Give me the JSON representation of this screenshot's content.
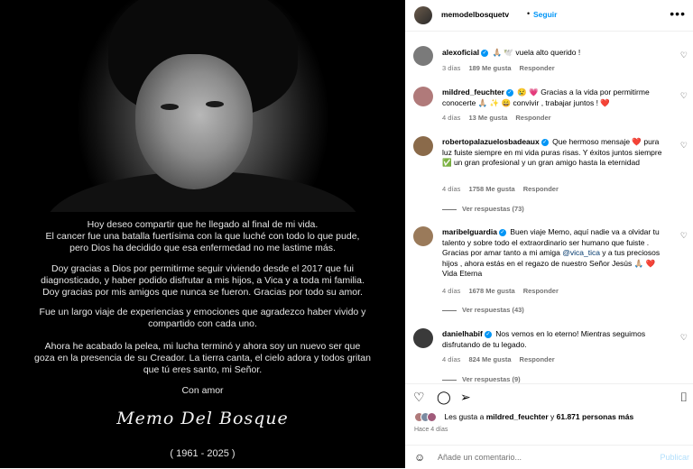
{
  "post": {
    "letter": [
      [
        "Hoy deseo compartir que he llegado al final de mi vida.",
        "El cancer fue una batalla fuertísima con la que luché con todo lo que pude,",
        "pero Dios ha decidido que esa enfermedad no me lastime más."
      ],
      [
        "Doy gracias a Dios por permitirme seguir viviendo desde el 2017 que fui",
        "diagnosticado, y haber podido disfrutar a mis hijos, a Vica y a toda mi familia.",
        "Doy gracias por mis amigos que nunca se fueron. Gracias por todo su amor."
      ],
      [
        "Fue un largo viaje de experiencias y emociones que agradezco haber vivido y",
        "compartido con cada uno."
      ],
      [
        "Ahora he acabado la pelea, mi lucha terminó y ahora soy un nuevo ser que",
        "goza en la presencia de su Creador.  La tierra canta, el cielo adora y todos gritan",
        "que tú eres santo, mi Señor."
      ],
      [
        "Con amor"
      ]
    ],
    "signature": "Memo Del Bosque",
    "years": "( 1961 - 2025 )"
  },
  "header": {
    "username": "memodelbosquetv",
    "separator": "•",
    "follow_label": "Seguir",
    "more_icon": "more-horizontal-icon"
  },
  "comments": [
    {
      "user": "alexoficial",
      "text": "🙏🏼 🕊️ vuela alto querido !",
      "age": "3 días",
      "likes": "189 Me gusta",
      "reply": "Responder",
      "avatar_color": "#7a7a7a"
    },
    {
      "user": "mildred_feuchter",
      "text": "😢 💗  Gracias a la vida por permitirme conocerte 🙏🏼 ✨ 😄 convivir , trabajar juntos ! ❤️",
      "age": "4 días",
      "likes": "13 Me gusta",
      "reply": "Responder",
      "avatar_color": "#b07a7a"
    },
    {
      "user": "robertopalazuelosbadeaux",
      "text": "Que hermoso mensaje ❤️ pura luz fuiste siempre en mi vida puras risas. Y éxitos juntos siempre ✅ un gran profesional y un gran amigo hasta la eternidad",
      "age": "4 días",
      "likes": "1758 Me gusta",
      "reply": "Responder",
      "view_replies": "Ver respuestas (73)",
      "avatar_color": "#8a6a4a"
    },
    {
      "user": "maribelguardia",
      "text_before": "Buen viaje Memo, aquí nadie va a olvidar tu talento y sobre todo el extraordinario ser humano que fuiste . Gracias por amar tanto a mi amiga ",
      "mention": "@vica_tica",
      "text_after": " y a tus preciosos hijos , ahora estás en el regazo de nuestro Señor Jesús 🙏🏼 ❤️ Vida Eterna",
      "age": "4 días",
      "likes": "1678 Me gusta",
      "reply": "Responder",
      "view_replies": "Ver respuestas (43)",
      "avatar_color": "#9a7a5a"
    },
    {
      "user": "danielhabif",
      "text": "Nos vemos en lo eterno! Mientras seguimos disfrutando de tu legado.",
      "age": "4 días",
      "likes": "824 Me gusta",
      "reply": "Responder",
      "view_replies": "Ver respuestas (9)",
      "avatar_color": "#3a3a3a"
    }
  ],
  "actions": {
    "like_icon": "heart-icon",
    "comment_icon": "comment-icon",
    "share_icon": "send-icon",
    "save_icon": "bookmark-icon"
  },
  "likes_summary": {
    "prefix": "Les gusta a ",
    "user": "mildred_feuchter",
    "middle": " y ",
    "count": "61.871 personas más"
  },
  "time_ago": "Hace 4 días",
  "add_comment": {
    "placeholder": "Añade un comentario...",
    "publish_label": "Publicar"
  },
  "colors": {
    "accent": "#0095f6",
    "verified": "#0095f6",
    "heart": "#ed4956"
  }
}
